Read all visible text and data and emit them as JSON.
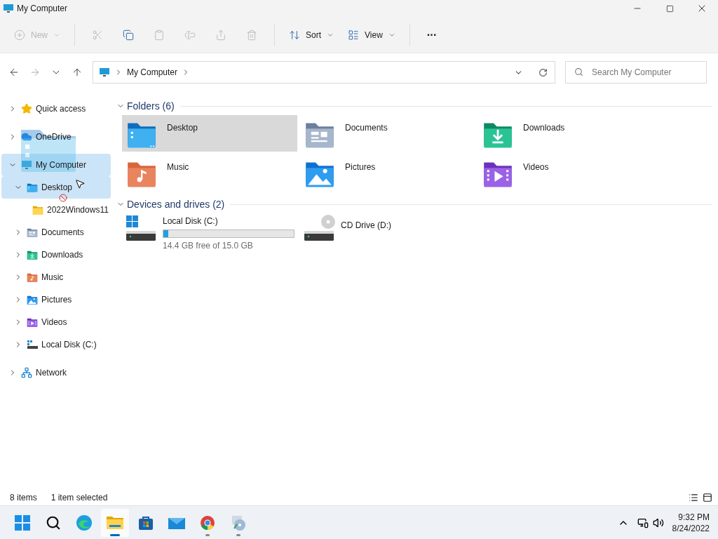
{
  "window": {
    "title": "My Computer"
  },
  "toolbar": [
    {
      "kind": "labeled",
      "label": "New",
      "disabled": true,
      "dropdown": true
    },
    {
      "kind": "icon",
      "disabled": true
    },
    {
      "kind": "icon",
      "disabled": false
    },
    {
      "kind": "icon",
      "disabled": true
    },
    {
      "kind": "icon",
      "disabled": true
    },
    {
      "kind": "icon",
      "disabled": true
    },
    {
      "kind": "icon",
      "disabled": true
    },
    {
      "kind": "labeled",
      "label": "Sort",
      "disabled": false,
      "dropdown": true
    },
    {
      "kind": "labeled",
      "label": "View",
      "disabled": false,
      "dropdown": true
    },
    {
      "kind": "more",
      "label": "···",
      "disabled": false
    }
  ],
  "navigation": {
    "back_disabled": false,
    "forward_disabled": true,
    "up_disabled": false
  },
  "address": {
    "segments": [
      "My Computer"
    ]
  },
  "search": {
    "placeholder": "Search My Computer"
  },
  "sidebar": {
    "items": [
      {
        "kind": "star",
        "label": "Quick access",
        "expanded": false,
        "selected": false
      },
      {
        "kind": "cloud",
        "label": "OneDrive",
        "expanded": false,
        "selected": false
      },
      {
        "kind": "pc",
        "label": "My Computer",
        "expanded": true,
        "selected": true,
        "children": [
          {
            "kind": "desktop",
            "label": "Desktop",
            "expanded": true,
            "selected": true,
            "children": [
              {
                "kind": "folder",
                "label": "2022Windows11",
                "selected": false
              }
            ]
          },
          {
            "kind": "documents",
            "label": "Documents",
            "expanded": false,
            "selected": false
          },
          {
            "kind": "downloads",
            "label": "Downloads",
            "expanded": false,
            "selected": false
          },
          {
            "kind": "music",
            "label": "Music",
            "expanded": false,
            "selected": false
          },
          {
            "kind": "pictures",
            "label": "Pictures",
            "expanded": false,
            "selected": false
          },
          {
            "kind": "videos",
            "label": "Videos",
            "expanded": false,
            "selected": false
          },
          {
            "kind": "drive",
            "label": "Local Disk (C:)",
            "expanded": false,
            "selected": false
          }
        ]
      },
      {
        "kind": "network",
        "label": "Network",
        "expanded": false,
        "selected": false
      }
    ]
  },
  "sections": [
    {
      "title": "Folders (6)",
      "expanded": true,
      "items": [
        {
          "kind": "desktop",
          "name": "Desktop",
          "selected": true
        },
        {
          "kind": "documents",
          "name": "Documents",
          "selected": false
        },
        {
          "kind": "downloads",
          "name": "Downloads",
          "selected": false
        },
        {
          "kind": "music",
          "name": "Music",
          "selected": false
        },
        {
          "kind": "pictures",
          "name": "Pictures",
          "selected": false
        },
        {
          "kind": "videos",
          "name": "Videos",
          "selected": false
        }
      ]
    },
    {
      "title": "Devices and drives (2)",
      "expanded": true,
      "items": [
        {
          "kind": "disk",
          "name": "Local Disk (C:)",
          "level": 0.04,
          "free": "14.4 GB free of 15.0 GB",
          "selected": false
        },
        {
          "kind": "cd",
          "name": "CD Drive (D:)",
          "selected": false
        }
      ]
    }
  ],
  "status_bar": {
    "count": "8 items",
    "selection": "1 item selected"
  },
  "taskbar": {
    "apps": [
      {
        "kind": "start",
        "running": false,
        "active": false
      },
      {
        "kind": "search",
        "running": false,
        "active": false
      },
      {
        "kind": "edge",
        "running": false,
        "active": false
      },
      {
        "kind": "explorer",
        "running": true,
        "active": true
      },
      {
        "kind": "store",
        "running": false,
        "active": false
      },
      {
        "kind": "mail",
        "running": false,
        "active": false
      },
      {
        "kind": "chrome",
        "running": true,
        "active": false
      },
      {
        "kind": "media",
        "running": true,
        "active": false
      }
    ],
    "time": "9:32 PM",
    "date": "8/24/2022"
  }
}
